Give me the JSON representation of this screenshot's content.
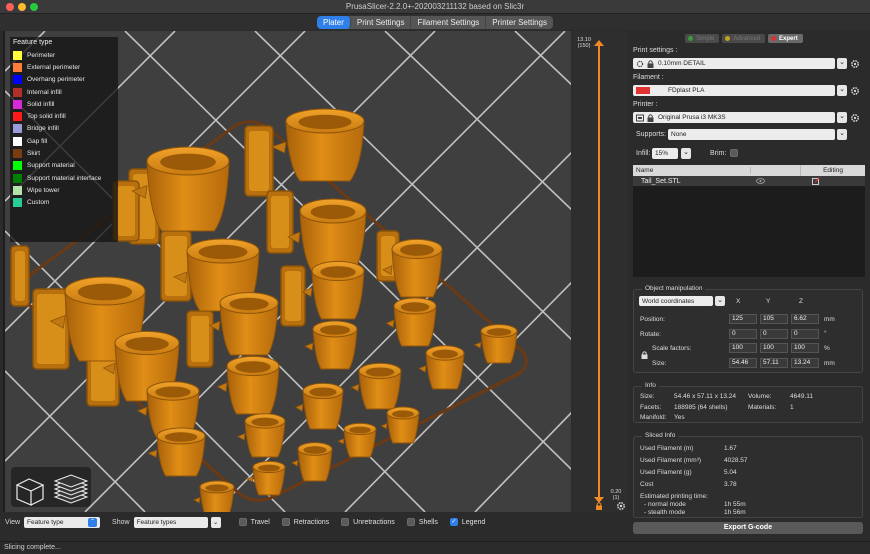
{
  "window": {
    "title": "PrusaSlicer-2.2.0+-202003211132 based on Slic3r"
  },
  "tabs": [
    {
      "label": "Plater",
      "active": true
    },
    {
      "label": "Print Settings",
      "active": false
    },
    {
      "label": "Filament Settings",
      "active": false
    },
    {
      "label": "Printer Settings",
      "active": false
    }
  ],
  "legend": {
    "title": "Feature type",
    "items": [
      {
        "label": "Perimeter",
        "color": "#ffff3c"
      },
      {
        "label": "External perimeter",
        "color": "#ff7d38"
      },
      {
        "label": "Overhang perimeter",
        "color": "#0000ff"
      },
      {
        "label": "Internal infill",
        "color": "#b03029"
      },
      {
        "label": "Solid infill",
        "color": "#d62ad8"
      },
      {
        "label": "Top solid infill",
        "color": "#ff1a1a"
      },
      {
        "label": "Bridge infill",
        "color": "#9b9bdb"
      },
      {
        "label": "Gap fill",
        "color": "#ffffff"
      },
      {
        "label": "Skirt",
        "color": "#7a3d10"
      },
      {
        "label": "Support material",
        "color": "#00ff00"
      },
      {
        "label": "Support material interface",
        "color": "#008000"
      },
      {
        "label": "Wipe tower",
        "color": "#b3e3ab"
      },
      {
        "label": "Custom",
        "color": "#28cc94"
      }
    ]
  },
  "slider": {
    "top_value": "13.10",
    "top_layer": "(150)",
    "bottom_value": "0.20",
    "bottom_layer": "(1)"
  },
  "bottom_bar": {
    "view_label": "View",
    "view_value": "Feature type",
    "show_label": "Show",
    "show_value": "Feature types",
    "travel": "Travel",
    "retractions": "Retractions",
    "unretractions": "Unretractions",
    "shells": "Shells",
    "legend": "Legend",
    "legend_checked": true
  },
  "status": "Slicing complete...",
  "modes": {
    "simple": "Simple",
    "advanced": "Advanced",
    "expert": "Expert",
    "active": "Expert"
  },
  "settings": {
    "print_label": "Print settings :",
    "print_value": "0.10mm DETAIL",
    "filament_label": "Filament :",
    "filament_value": "FDplast PLA",
    "filament_color": "#e33232",
    "printer_label": "Printer :",
    "printer_value": "Original Prusa i3 MK3S",
    "supports_label": "Supports:",
    "supports_value": "None",
    "infill_label": "Infill:",
    "infill_value": "15%",
    "brim_label": "Brim:"
  },
  "object_list": {
    "col_name": "Name",
    "col_editing": "Editing",
    "objects": [
      {
        "name": "Tail_Set.STL"
      }
    ]
  },
  "manipulation": {
    "title": "Object manipulation",
    "coords": "World coordinates",
    "axis_x": "X",
    "axis_y": "Y",
    "axis_z": "Z",
    "position_label": "Position:",
    "position": [
      "125",
      "105",
      "6.62"
    ],
    "position_unit": "mm",
    "rotate_label": "Rotate:",
    "rotate": [
      "0",
      "0",
      "0"
    ],
    "rotate_unit": "°",
    "scale_label": "Scale factors:",
    "scale": [
      "100",
      "100",
      "100"
    ],
    "scale_unit": "%",
    "size_label": "Size:",
    "size": [
      "54.46",
      "57.11",
      "13.24"
    ],
    "size_unit": "mm"
  },
  "info": {
    "title": "Info",
    "size_label": "Size:",
    "size_value": "54.46 x 57.11 x 13.24",
    "volume_label": "Volume:",
    "volume_value": "4649.11",
    "facets_label": "Facets:",
    "facets_value": "188985 (64 shells)",
    "materials_label": "Materials:",
    "materials_value": "1",
    "manifold_label": "Manifold:",
    "manifold_value": "Yes"
  },
  "sliced_info": {
    "title": "Sliced Info",
    "rows": [
      {
        "label": "Used Filament (m)",
        "value": "1.67"
      },
      {
        "label": "Used Filament (mm³)",
        "value": "4028.57"
      },
      {
        "label": "Used Filament (g)",
        "value": "5.04"
      },
      {
        "label": "Cost",
        "value": "3.78"
      }
    ],
    "time_label": "Estimated printing time:",
    "normal_label": "- normal mode",
    "normal_value": "1h 55m",
    "stealth_label": "- stealth mode",
    "stealth_value": "1h 56m"
  },
  "export_button": "Export G-code"
}
